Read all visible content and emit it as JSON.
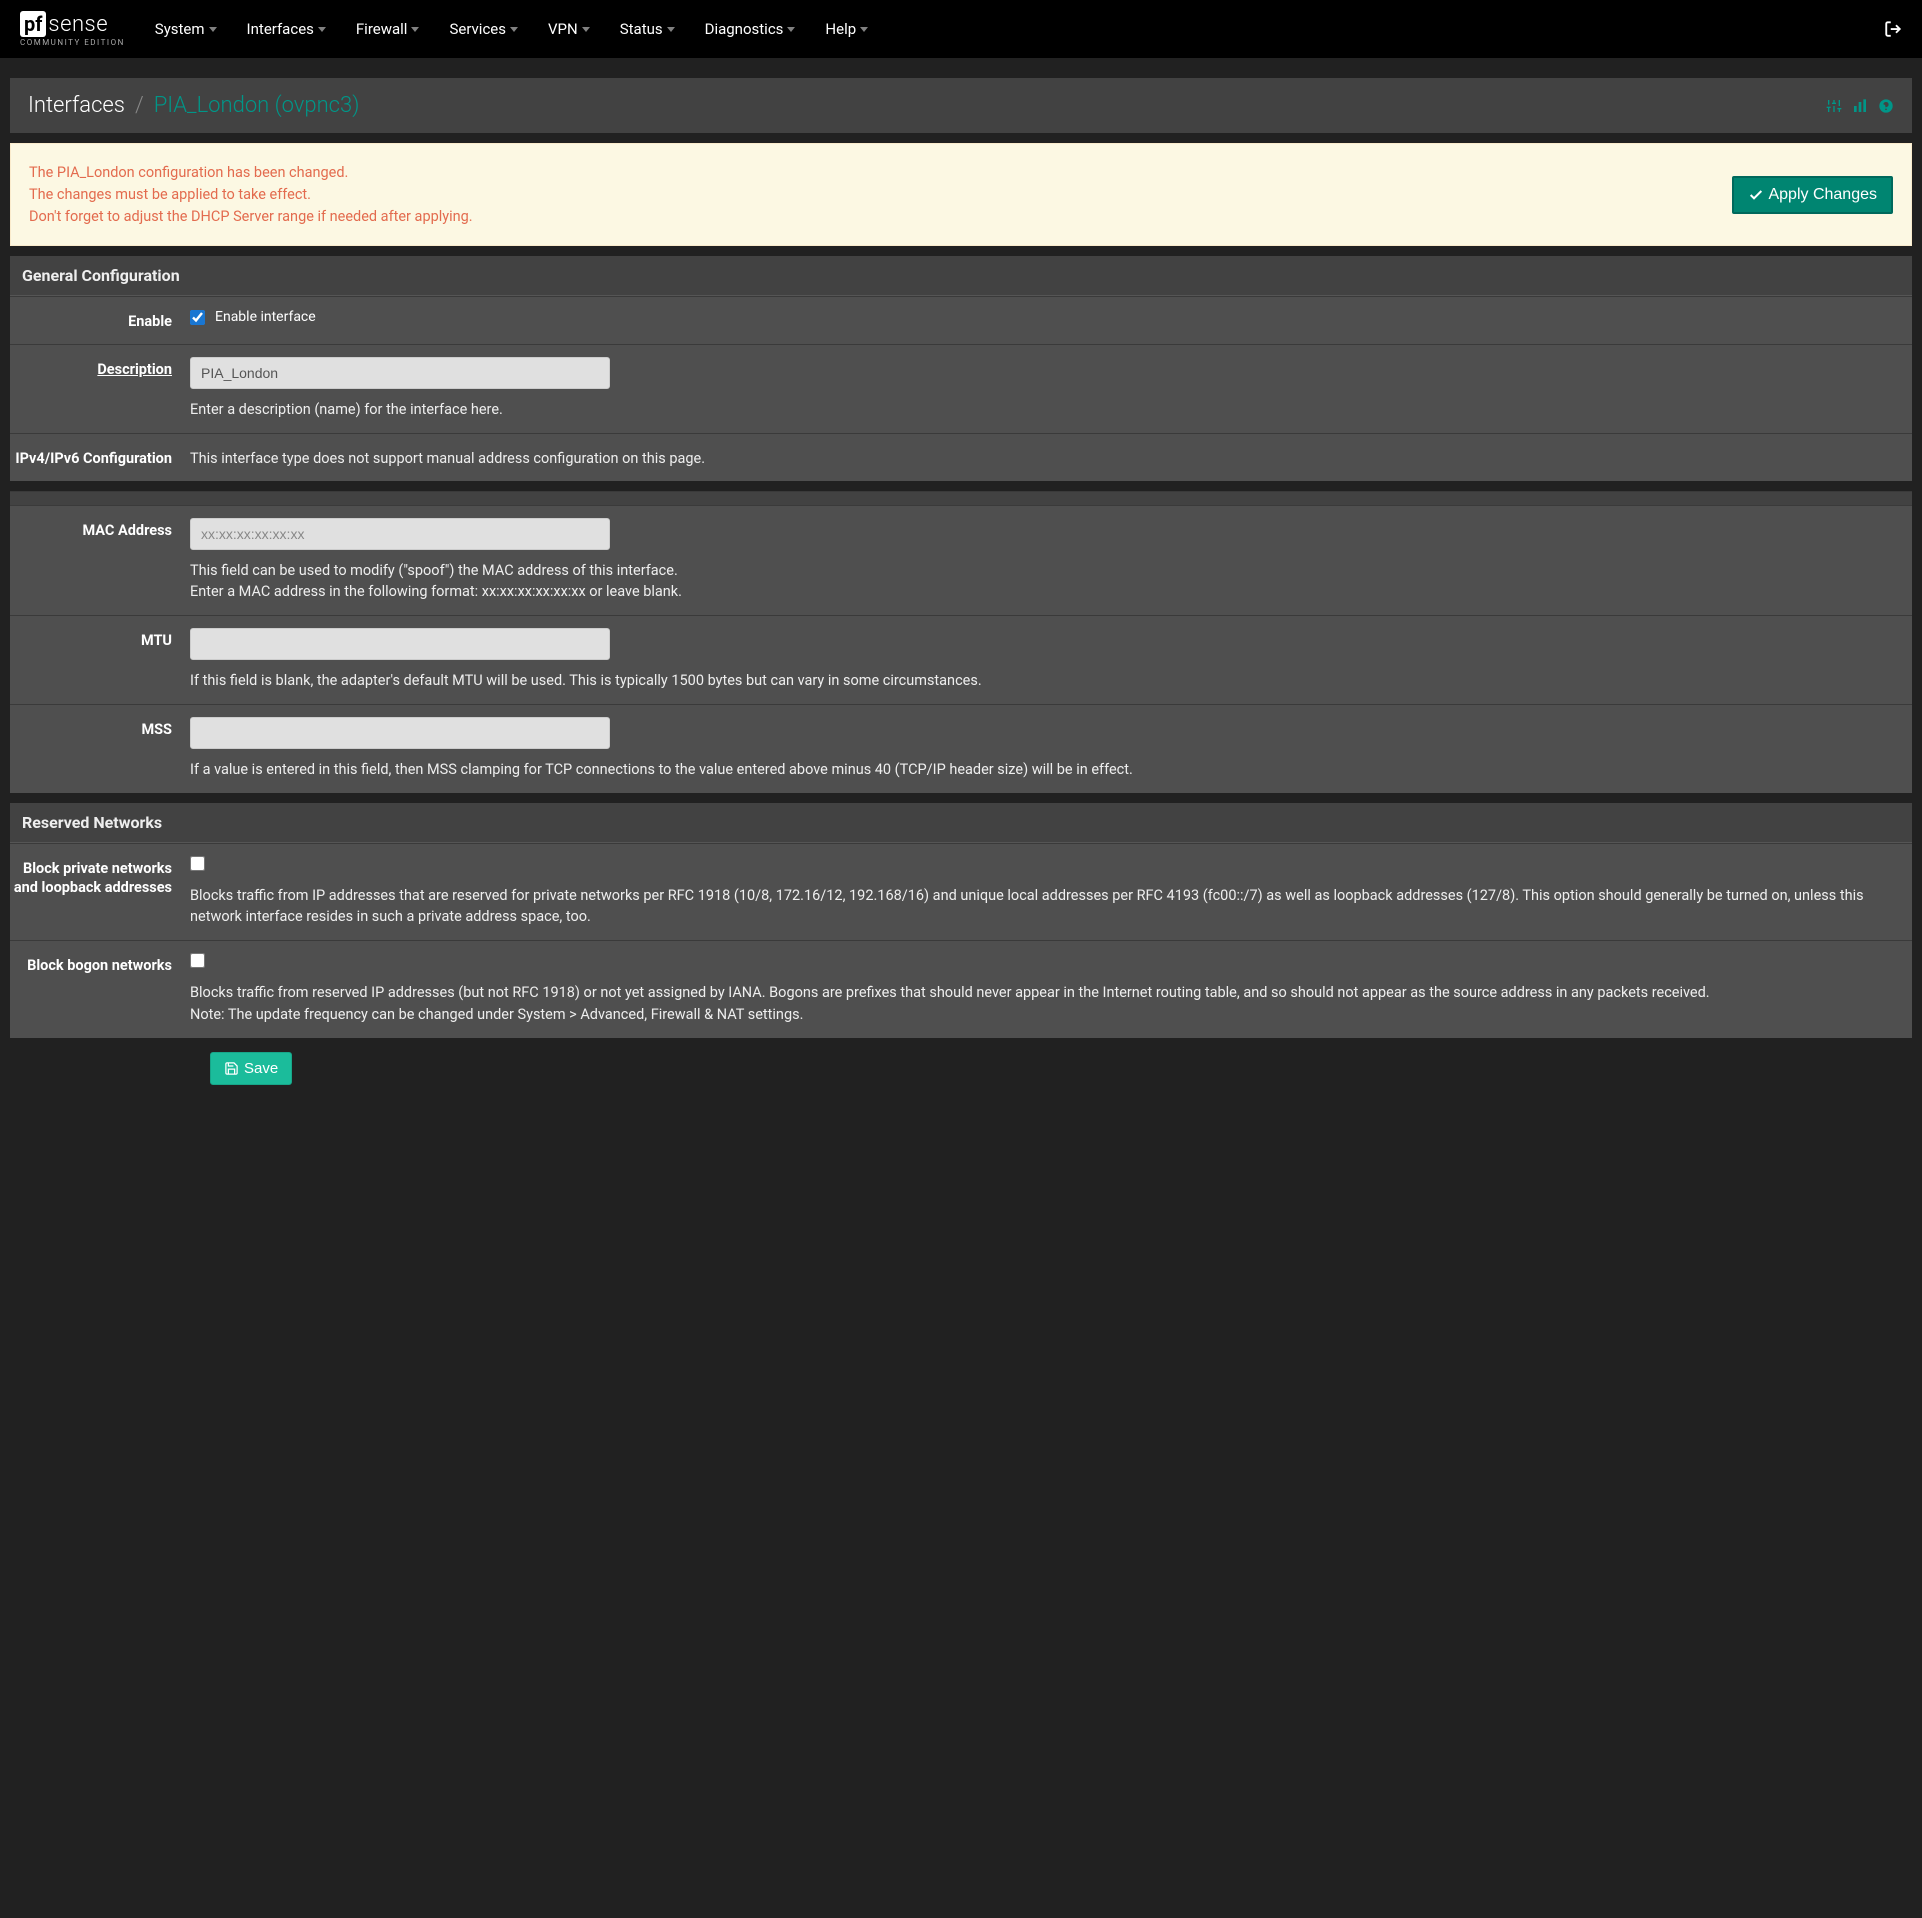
{
  "logo": {
    "pf": "pf",
    "sense": "sense",
    "subtitle": "COMMUNITY EDITION"
  },
  "nav": {
    "items": [
      "System",
      "Interfaces",
      "Firewall",
      "Services",
      "VPN",
      "Status",
      "Diagnostics",
      "Help"
    ]
  },
  "breadcrumb": {
    "root": "Interfaces",
    "active": "PIA_London (ovpnc3)"
  },
  "alert": {
    "line1": "The PIA_London configuration has been changed.",
    "line2": "The changes must be applied to take effect.",
    "line3": "Don't forget to adjust the DHCP Server range if needed after applying.",
    "apply_label": "Apply Changes"
  },
  "panels": {
    "general": {
      "title": "General Configuration",
      "enable": {
        "label": "Enable",
        "checkbox_label": "Enable interface",
        "checked": true
      },
      "description": {
        "label": "Description",
        "value": "PIA_London",
        "help": "Enter a description (name) for the interface here."
      },
      "ipconfig": {
        "label": "IPv4/IPv6 Configuration",
        "text": "This interface type does not support manual address configuration on this page."
      },
      "mac": {
        "label": "MAC Address",
        "placeholder": "xx:xx:xx:xx:xx:xx",
        "help1": "This field can be used to modify (\"spoof\") the MAC address of this interface.",
        "help2": "Enter a MAC address in the following format: xx:xx:xx:xx:xx:xx or leave blank."
      },
      "mtu": {
        "label": "MTU",
        "help": "If this field is blank, the adapter's default MTU will be used. This is typically 1500 bytes but can vary in some circumstances."
      },
      "mss": {
        "label": "MSS",
        "help": "If a value is entered in this field, then MSS clamping for TCP connections to the value entered above minus 40 (TCP/IP header size) will be in effect."
      }
    },
    "reserved": {
      "title": "Reserved Networks",
      "block_private": {
        "label": "Block private networks and loopback addresses",
        "help": "Blocks traffic from IP addresses that are reserved for private networks per RFC 1918 (10/8, 172.16/12, 192.168/16) and unique local addresses per RFC 4193 (fc00::/7) as well as loopback addresses (127/8). This option should generally be turned on, unless this network interface resides in such a private address space, too."
      },
      "block_bogon": {
        "label": "Block bogon networks",
        "help1": "Blocks traffic from reserved IP addresses (but not RFC 1918) or not yet assigned by IANA. Bogons are prefixes that should never appear in the Internet routing table, and so should not appear as the source address in any packets received.",
        "help2": "Note: The update frequency can be changed under System > Advanced, Firewall & NAT settings."
      }
    }
  },
  "save_label": "Save"
}
